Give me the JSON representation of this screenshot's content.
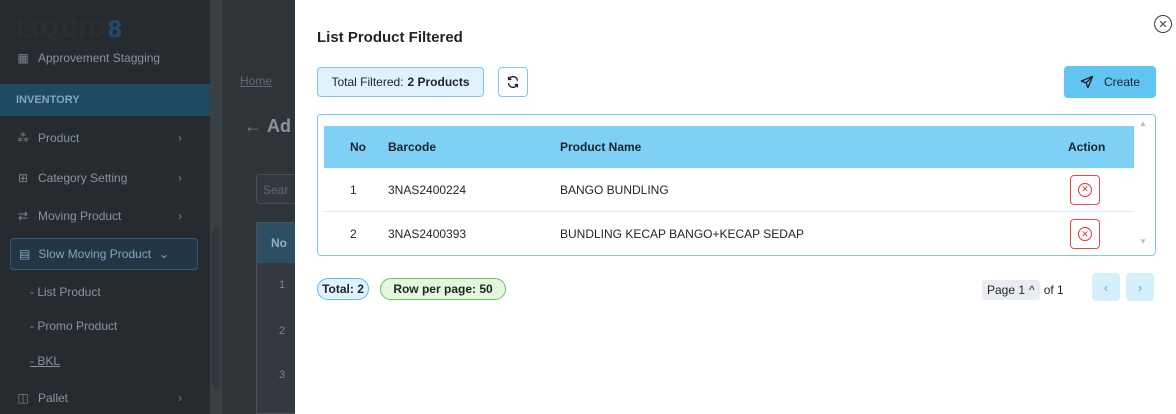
{
  "colors": {
    "accent": "#62c5f1",
    "table_header": "#7fd0f5",
    "danger": "#d93535",
    "success_badge": "#6bc45a"
  },
  "background": {
    "logo_main": "LIQUID",
    "logo_suffix": "8",
    "sidebar": {
      "top_item": "Approvement Stagging",
      "section": "INVENTORY",
      "items": [
        {
          "label": "Product",
          "icon": "cubes-icon"
        },
        {
          "label": "Category Setting",
          "icon": "category-icon"
        },
        {
          "label": "Moving Product",
          "icon": "arrows-icon"
        },
        {
          "label": "Slow Moving Product",
          "icon": "building-icon"
        }
      ],
      "sub_items": [
        "- List Product",
        "- Promo Product",
        "- BKL"
      ],
      "bottom_item": "Pallet"
    },
    "breadcrumb": "Home",
    "title_partial": "Ad",
    "search_partial": "Sear",
    "table_header_partial": "No",
    "row_numbers": [
      "1",
      "2",
      "3"
    ]
  },
  "modal": {
    "title": "List Product Filtered",
    "total_filtered_label": "Total Filtered:",
    "total_filtered_value": "2 Products",
    "create_label": "Create",
    "table": {
      "columns": [
        "No",
        "Barcode",
        "Product Name",
        "Action"
      ],
      "rows": [
        {
          "no": "1",
          "barcode": "3NAS2400224",
          "name": "BANGO BUNDLING"
        },
        {
          "no": "2",
          "barcode": "3NAS2400393",
          "name": "BUNDLING KECAP BANGO+KECAP SEDAP"
        }
      ]
    },
    "footer": {
      "total_badge": "Total: 2",
      "rows_badge": "Row per page: 50",
      "page_label": "Page 1",
      "of_label": "of 1"
    }
  }
}
